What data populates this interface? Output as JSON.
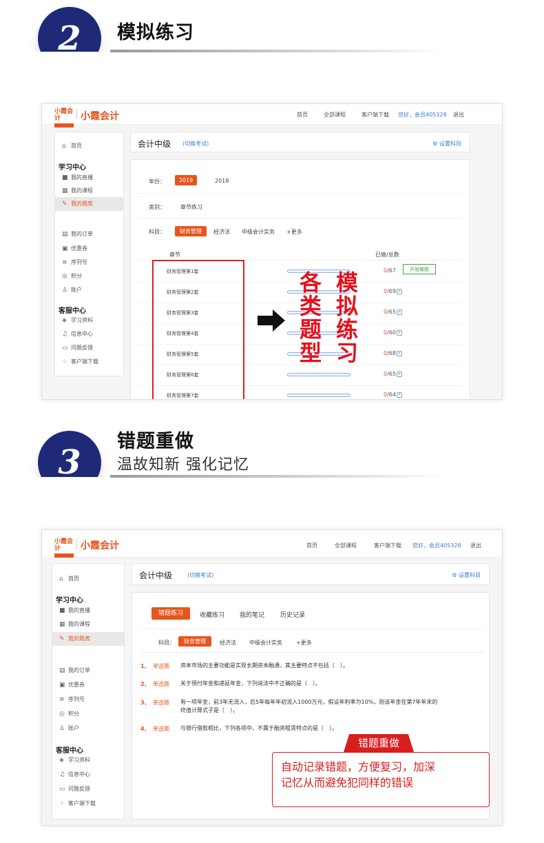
{
  "section2": {
    "number": "2",
    "title": "模拟练习"
  },
  "section3": {
    "number": "3",
    "title": "错题重做",
    "subtitle": "温故知新  强化记忆"
  },
  "app": {
    "logo_small": "小霞会计",
    "brand": "小霞会计",
    "nav": [
      "首页",
      "全部课程",
      "客户端下载"
    ],
    "user": "您好，会员405328",
    "logout": "退出",
    "sidebar": {
      "home": "首页",
      "study_center": "学习中心",
      "study_items": [
        "我的直播",
        "我的课程",
        "我的题库"
      ],
      "account_items": [
        "我的订单",
        "优惠券",
        "序列号",
        "积分",
        "账户"
      ],
      "service_center": "客服中心",
      "service_items": [
        "学习资料",
        "信息中心",
        "问题反馈",
        "客户端下载"
      ]
    },
    "header": {
      "title": "会计中级",
      "switch": "(切换考试)",
      "settings": "设置科目"
    }
  },
  "practice": {
    "year_label": "年份：",
    "years": [
      "2019",
      "2018"
    ],
    "category_label": "类别：",
    "category_value": "章节练习",
    "subject_label": "科目：",
    "subjects": [
      "财务管理",
      "经济法",
      "中级会计实务",
      "+更多"
    ],
    "col_chapter": "章节",
    "col_progress": "已做/总数",
    "start_button": "开始做题",
    "rows": [
      {
        "name": "财务管理第1套",
        "done": "0",
        "total": "/67"
      },
      {
        "name": "财务管理第2套",
        "done": "0",
        "total": "/69"
      },
      {
        "name": "财务管理第3套",
        "done": "0",
        "total": "/65"
      },
      {
        "name": "财务管理第4套",
        "done": "0",
        "total": "/60"
      },
      {
        "name": "财务管理第5套",
        "done": "0",
        "total": "/68"
      },
      {
        "name": "财务管理第6套",
        "done": "0",
        "total": "/65"
      },
      {
        "name": "财务管理第7套",
        "done": "0",
        "total": "/64"
      }
    ],
    "overlay_left": [
      "各",
      "类",
      "题",
      "型"
    ],
    "overlay_right": [
      "模",
      "拟",
      "练",
      "习"
    ]
  },
  "wrong": {
    "tabs": [
      "错题练习",
      "收藏练习",
      "我的笔记",
      "历史记录"
    ],
    "subject_label": "科目：",
    "subjects": [
      "财务管理",
      "经济法",
      "中级会计实务",
      "+更多"
    ],
    "questions": [
      {
        "num": "1、",
        "type": "单选题",
        "text": "资本市场的主要功能是实现长期资本融通，其主要特点不包括（　）。"
      },
      {
        "num": "2、",
        "type": "单选题",
        "text": "关于预付年金和递延年金，下列说法中不正确的是（　）。"
      },
      {
        "num": "3、",
        "type": "单选题",
        "text": "有一项年金，前3年无流入，后5年每年年初流入1000万元，假设年利率为10%，则该年金在第7年年末的",
        "text2": "终值计算式子是（　）。"
      },
      {
        "num": "4、",
        "type": "单选题",
        "text": "与银行借款相比，下列各项中，不属于融资租赁特点的是（　）。"
      }
    ],
    "callout_tab": "错题重做",
    "callout_line1": "自动记录错题，方便复习，加深",
    "callout_line2": "记忆从而避免犯同样的错误"
  },
  "colors": {
    "accent": "#e8541e",
    "navy": "#1e2a78",
    "red": "#e21d1d"
  }
}
